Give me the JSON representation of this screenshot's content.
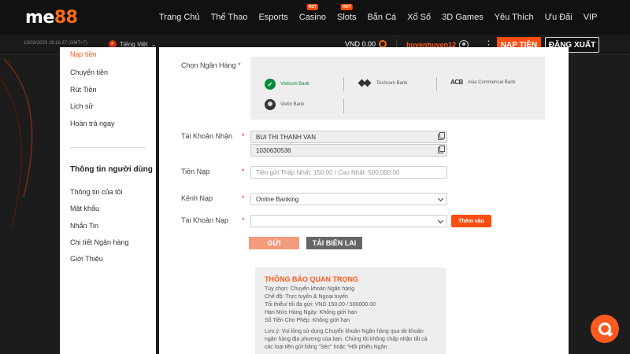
{
  "brand": {
    "logo_main": "me",
    "logo_accent": "88"
  },
  "nav": {
    "items": [
      "Trang Chủ",
      "Thể Thao",
      "Esports",
      "Casino",
      "Slots",
      "Bắn Cá",
      "Xổ Số",
      "3D Games",
      "Yêu Thích",
      "Ưu Đãi",
      "VIP"
    ],
    "hot_badge": "HOT"
  },
  "subbar": {
    "datetime": "15/03/2023 19:16:37 (GMT+7)",
    "language": "Tiếng Việt",
    "balance": "VND 0.00",
    "username": "huyenhuyen12",
    "deposit_label": "NẠP TIỀN",
    "logout_label": "ĐĂNG XUẤT"
  },
  "sidebar": {
    "top_partial": "Nạp tiền",
    "items": [
      "Chuyển tiền",
      "Rút Tiền",
      "Lịch sử",
      "Hoàn trả ngay"
    ],
    "user_heading": "Thông tin người dùng",
    "user_items": [
      "Thông tin của tôi",
      "Mật khẩu",
      "Nhắn Tin",
      "Chi tiết Ngân hàng",
      "Giới Thiệu"
    ]
  },
  "form": {
    "bank_label": "Chọn Ngân Hàng",
    "banks": [
      "Vietcom Bank",
      "Techcom Bank",
      "Asia Commercial Bank",
      "Vietin Bank"
    ],
    "acb_logo_text": "ACB",
    "receive_label": "Tài Khoản Nhận",
    "receive_name": "BUI THI THANH VAN",
    "receive_number": "1030630536",
    "amount_label": "Tiền Nạp",
    "amount_placeholder": "Tiền gửi Thấp Nhất: 150.00 / Cao Nhất: 500,000.00",
    "channel_label": "Kênh Nạp",
    "channel_value": "Online Banking",
    "account_label": "Tài Khoản Nạp",
    "account_value": "",
    "add_label": "Thêm vào",
    "send_label": "GỬI",
    "reload_label": "TẢI BIÊN LAI",
    "required_mark": "*"
  },
  "notice": {
    "title": "THÔNG BÁO QUAN TRỌNG",
    "lines": [
      "Tùy chọn: Chuyển khoản Ngân hàng",
      "Chế độ: Trực tuyến & Ngoại tuyến",
      "Tối thiểu/ tối đa gửi: VND 150.00 / 500000.00",
      "Hạn Mức Hàng Ngày: Không giới hạn",
      "Số Tiền Cho Phép: Không giới hạn"
    ],
    "note": "Lưu ý: Vui lòng sử dụng Chuyển khoản Ngân hàng qua tài khoản ngân hàng địa phương của bạn. Chúng tôi không chấp nhận tất cả các loại tiền gửi bằng \"Séc\" hoặc \"Hối phiếu Ngân"
  },
  "colors": {
    "accent": "#ff4d12",
    "nav_bg": "#111111",
    "panel_bg": "#eeeeee"
  }
}
